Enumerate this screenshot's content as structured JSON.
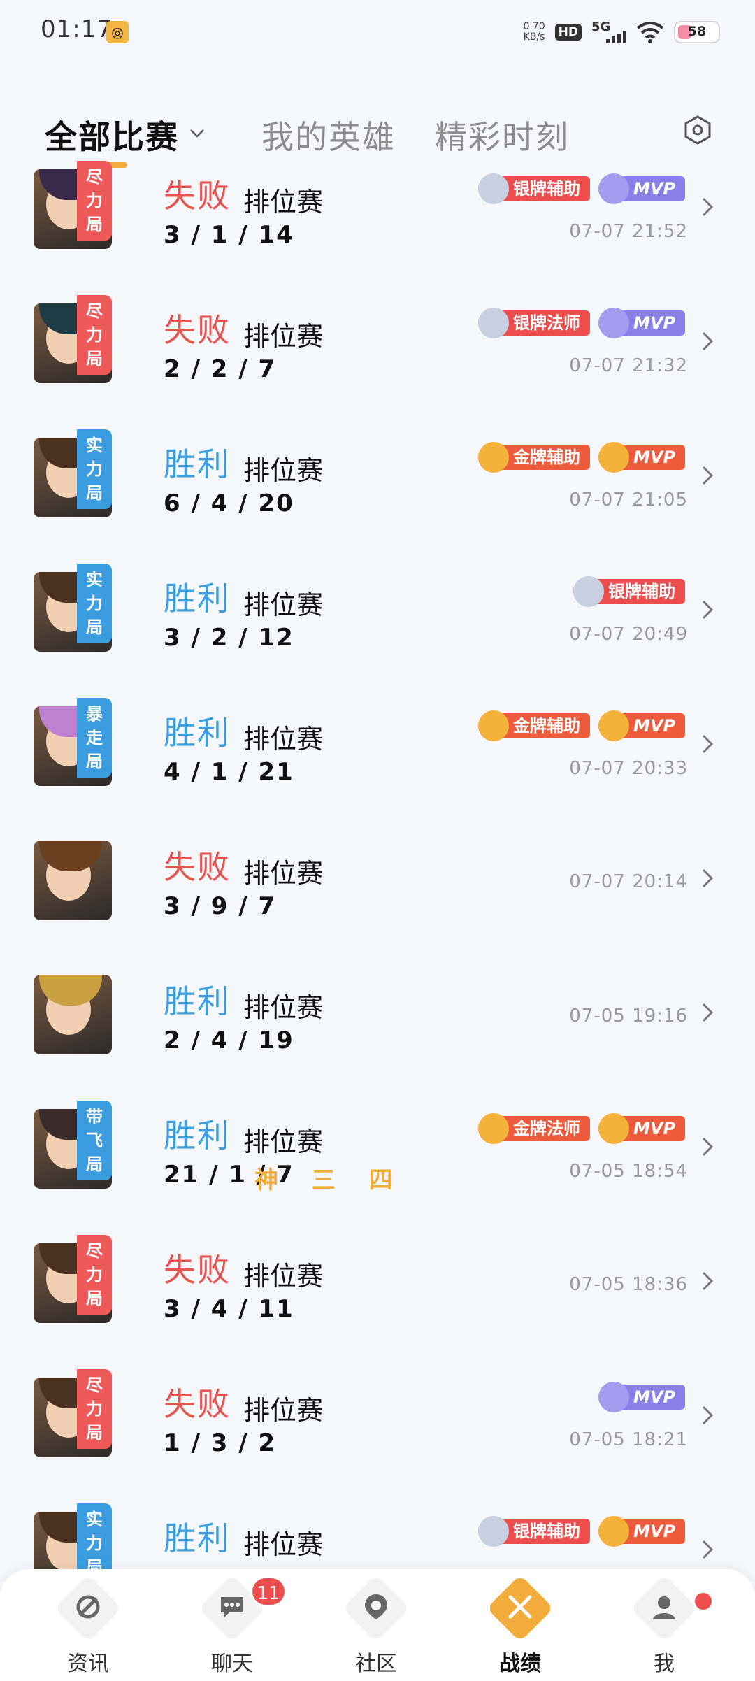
{
  "status_bar": {
    "time": "01:17",
    "net_speed_value": "0.70",
    "net_speed_unit": "KB/s",
    "hd_label": "HD",
    "network_label": "5G",
    "battery_level": "58"
  },
  "tabs": [
    {
      "label": "全部比赛"
    },
    {
      "label": "我的英雄"
    },
    {
      "label": "精彩时刻"
    }
  ],
  "matches": [
    {
      "result": "失败",
      "type": "排位赛",
      "kda": "3 / 1 / 14",
      "tag": "尽力局",
      "badges": [
        "银牌辅助",
        "MVP"
      ],
      "time": "07-07 21:52"
    },
    {
      "result": "失败",
      "type": "排位赛",
      "kda": "2 / 2 / 7",
      "tag": "尽力局",
      "badges": [
        "银牌法师",
        "MVP"
      ],
      "time": "07-07 21:32"
    },
    {
      "result": "胜利",
      "type": "排位赛",
      "kda": "6 / 4 / 20",
      "tag": "实力局",
      "badges": [
        "金牌辅助",
        "MVP"
      ],
      "time": "07-07 21:05"
    },
    {
      "result": "胜利",
      "type": "排位赛",
      "kda": "3 / 2 / 12",
      "tag": "实力局",
      "badges": [
        "银牌辅助"
      ],
      "time": "07-07 20:49"
    },
    {
      "result": "胜利",
      "type": "排位赛",
      "kda": "4 / 1 / 21",
      "tag": "暴走局",
      "badges": [
        "金牌辅助",
        "MVP"
      ],
      "time": "07-07 20:33"
    },
    {
      "result": "失败",
      "type": "排位赛",
      "kda": "3 / 9 / 7",
      "tag": "",
      "badges": [],
      "time": "07-07 20:14"
    },
    {
      "result": "胜利",
      "type": "排位赛",
      "kda": "2 / 4 / 19",
      "tag": "",
      "badges": [],
      "time": "07-05 19:16"
    },
    {
      "result": "胜利",
      "type": "排位赛",
      "kda": "21 / 1 / 7",
      "highlight": "神 三 四",
      "tag": "带飞局",
      "badges": [
        "金牌法师",
        "MVP"
      ],
      "time": "07-05 18:54"
    },
    {
      "result": "失败",
      "type": "排位赛",
      "kda": "3 / 4 / 11",
      "tag": "尽力局",
      "badges": [],
      "time": "07-05 18:36"
    },
    {
      "result": "失败",
      "type": "排位赛",
      "kda": "1 / 3 / 2",
      "tag": "尽力局",
      "badges": [
        "MVP"
      ],
      "time": "07-05 18:21"
    },
    {
      "result": "胜利",
      "type": "排位赛",
      "kda": "",
      "tag": "实力局",
      "badges": [
        "银牌辅助",
        "MVP"
      ],
      "time": ""
    }
  ],
  "bottom_nav": [
    {
      "label": "资讯",
      "icon": "news-icon"
    },
    {
      "label": "聊天",
      "icon": "chat-icon",
      "badge": "11"
    },
    {
      "label": "社区",
      "icon": "community-icon"
    },
    {
      "label": "战绩",
      "icon": "crossed-swords-icon",
      "active": true
    },
    {
      "label": "我",
      "icon": "profile-icon"
    }
  ],
  "colors": {
    "win": "#3c9ee0",
    "lose": "#ea5451",
    "accent": "#f2ac3c",
    "tag_effort": "#ee5a5a",
    "tag_strength": "#3b9de0"
  }
}
